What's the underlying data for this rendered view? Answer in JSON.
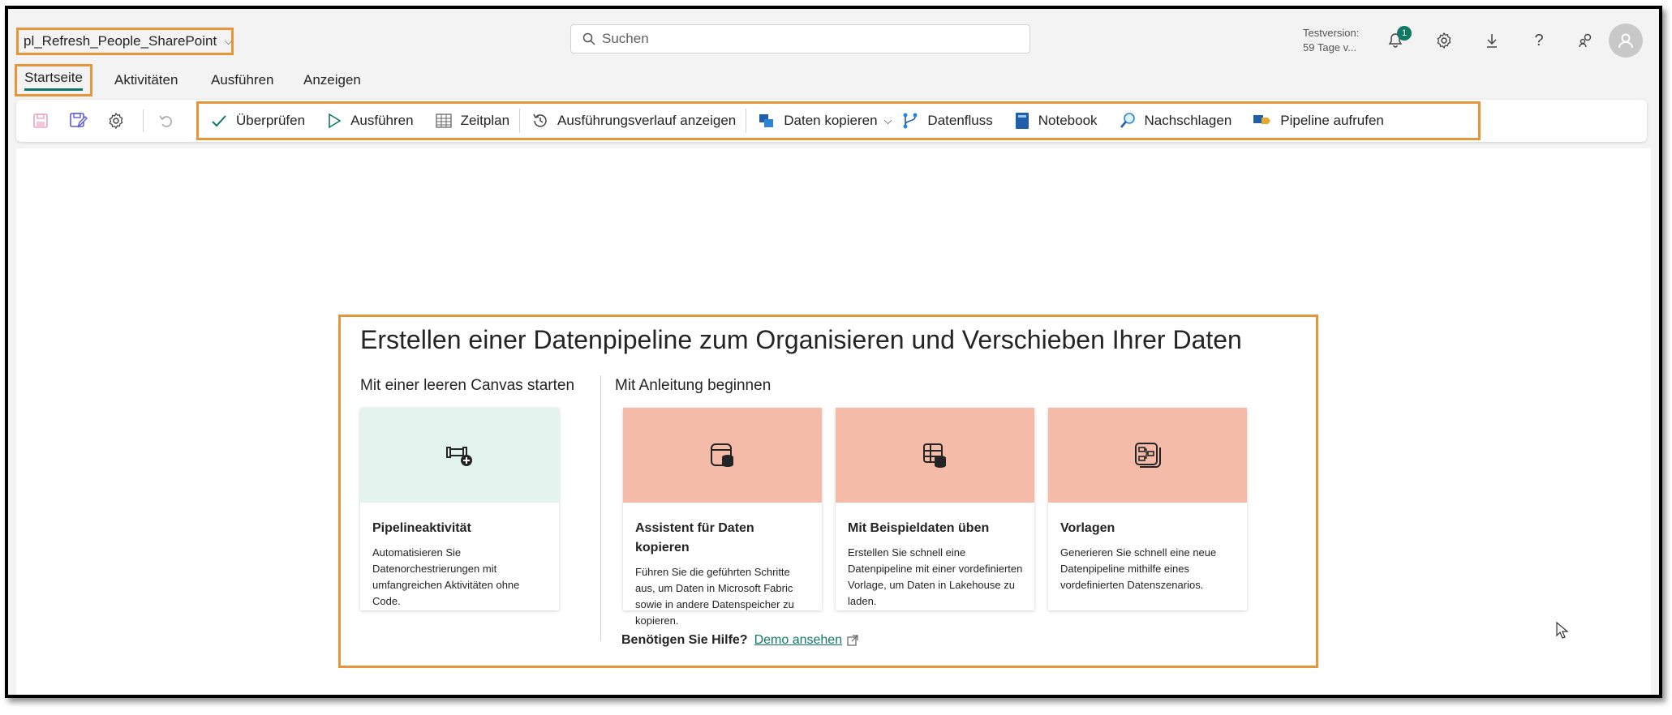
{
  "header": {
    "pipeline_name": "pl_Refresh_People_SharePoint",
    "search_placeholder": "Suchen",
    "trial_line1": "Testversion:",
    "trial_line2": "59 Tage v...",
    "notification_count": "1"
  },
  "tabs": [
    {
      "label": "Startseite",
      "active": true
    },
    {
      "label": "Aktivitäten"
    },
    {
      "label": "Ausführen"
    },
    {
      "label": "Anzeigen"
    }
  ],
  "toolbar": {
    "validate": "Überprüfen",
    "run": "Ausführen",
    "schedule": "Zeitplan",
    "run_history": "Ausführungsverlauf anzeigen",
    "copy_data": "Daten kopieren",
    "dataflow": "Datenfluss",
    "notebook": "Notebook",
    "lookup": "Nachschlagen",
    "invoke_pipeline": "Pipeline aufrufen"
  },
  "main": {
    "title": "Erstellen einer Datenpipeline zum Organisieren und Verschieben Ihrer Daten",
    "blank_section": "Mit einer leeren Canvas starten",
    "guided_section": "Mit Anleitung beginnen",
    "cards": [
      {
        "title": "Pipelineaktivität",
        "desc": "Automatisieren Sie Datenorchestrierungen mit umfangreichen Aktivitäten ohne Code."
      },
      {
        "title": "Assistent für Daten kopieren",
        "desc": "Führen Sie die geführten Schritte aus, um Daten in Microsoft Fabric sowie in andere Datenspeicher zu kopieren."
      },
      {
        "title": "Mit Beispieldaten üben",
        "desc": "Erstellen Sie schnell eine Datenpipeline mit einer vordefinierten Vorlage, um Daten in Lakehouse zu laden."
      },
      {
        "title": "Vorlagen",
        "desc": "Generieren Sie schnell eine neue Datenpipeline mithilfe eines vordefinierten Datenszenarios."
      }
    ],
    "help_label": "Benötigen Sie Hilfe?",
    "help_link": "Demo ansehen"
  },
  "colors": {
    "highlight": "#e5963a",
    "accent": "#117865",
    "card_blank": "#e3f4ee",
    "card_guided": "#f4bba8"
  }
}
